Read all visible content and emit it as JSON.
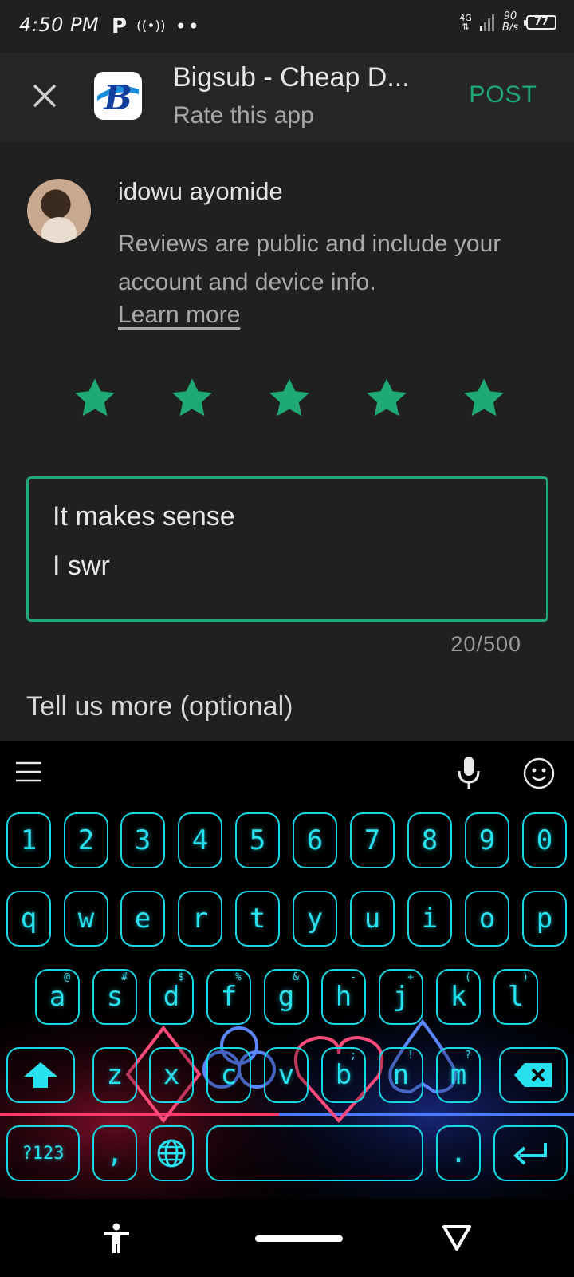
{
  "status_bar": {
    "time": "4:50 PM",
    "network": "4G",
    "speed_value": "90",
    "speed_unit": "B/s",
    "battery": "77"
  },
  "header": {
    "app_title": "Bigsub - Cheap D...",
    "subtitle": "Rate this app",
    "post_label": "POST",
    "app_icon_letter": "B"
  },
  "reviewer": {
    "name": "idowu ayomide",
    "disclaimer": "Reviews are public and include your account and device info.",
    "learn_more": "Learn more"
  },
  "rating": {
    "stars_selected": 5,
    "stars_total": 5,
    "star_color": "#1fa974"
  },
  "review": {
    "lines": [
      "It makes sense",
      "I swr"
    ],
    "char_count": "20/500",
    "tell_more_label": "Tell us more (optional)"
  },
  "keyboard": {
    "accent_color": "#19d8e6",
    "number_row": [
      "1",
      "2",
      "3",
      "4",
      "5",
      "6",
      "7",
      "8",
      "9",
      "0"
    ],
    "row1": [
      "q",
      "w",
      "e",
      "r",
      "t",
      "y",
      "u",
      "i",
      "o",
      "p"
    ],
    "row2": [
      {
        "key": "a",
        "hint": "@"
      },
      {
        "key": "s",
        "hint": "#"
      },
      {
        "key": "d",
        "hint": "$"
      },
      {
        "key": "f",
        "hint": "%"
      },
      {
        "key": "g",
        "hint": "&"
      },
      {
        "key": "h",
        "hint": "-"
      },
      {
        "key": "j",
        "hint": "+"
      },
      {
        "key": "k",
        "hint": "("
      },
      {
        "key": "l",
        "hint": ")"
      }
    ],
    "row3": [
      {
        "key": "z",
        "hint": ""
      },
      {
        "key": "x",
        "hint": ""
      },
      {
        "key": "c",
        "hint": ""
      },
      {
        "key": "v",
        "hint": ""
      },
      {
        "key": "b",
        "hint": ";"
      },
      {
        "key": "n",
        "hint": "!"
      },
      {
        "key": "m",
        "hint": "?"
      }
    ],
    "symbols_label": "?123",
    "comma": ",",
    "period": "."
  }
}
